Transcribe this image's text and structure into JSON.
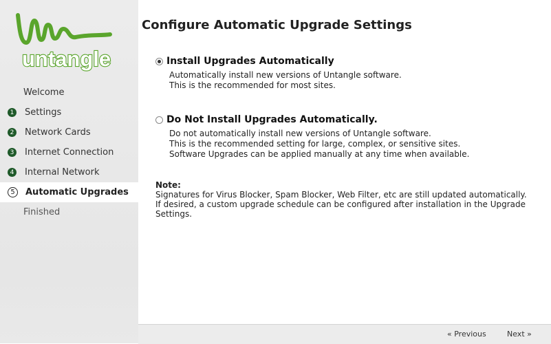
{
  "brand": {
    "logo_text": "untangle",
    "logo_color": "#5aa52c"
  },
  "sidebar": {
    "steps": [
      {
        "number": "",
        "label": "Welcome"
      },
      {
        "number": "1",
        "label": "Settings"
      },
      {
        "number": "2",
        "label": "Network Cards"
      },
      {
        "number": "3",
        "label": "Internet Connection"
      },
      {
        "number": "4",
        "label": "Internal Network"
      },
      {
        "number": "5",
        "label": "Automatic Upgrades"
      },
      {
        "number": "",
        "label": "Finished"
      }
    ],
    "active_step": "Automatic Upgrades"
  },
  "main": {
    "title": "Configure Automatic Upgrade Settings",
    "options": [
      {
        "label": "Install Upgrades Automatically",
        "checked": true,
        "desc1": "Automatically install new versions of Untangle software.",
        "desc2": "This is the recommended for most sites."
      },
      {
        "label": "Do Not Install Upgrades Automatically.",
        "checked": false,
        "desc1": "Do not automatically install new versions of Untangle software.",
        "desc2": "This is the recommended setting for large, complex, or sensitive sites.",
        "desc3": "Software Upgrades can be applied manually at any time when available."
      }
    ],
    "note": {
      "title": "Note:",
      "line1": "Signatures for Virus Blocker, Spam Blocker, Web Filter, etc are still updated automatically.",
      "line2": "If desired, a custom upgrade schedule can be configured after installation in the Upgrade",
      "line3": "Settings."
    }
  },
  "footer": {
    "previous_label": "« Previous",
    "next_label": "Next »"
  }
}
